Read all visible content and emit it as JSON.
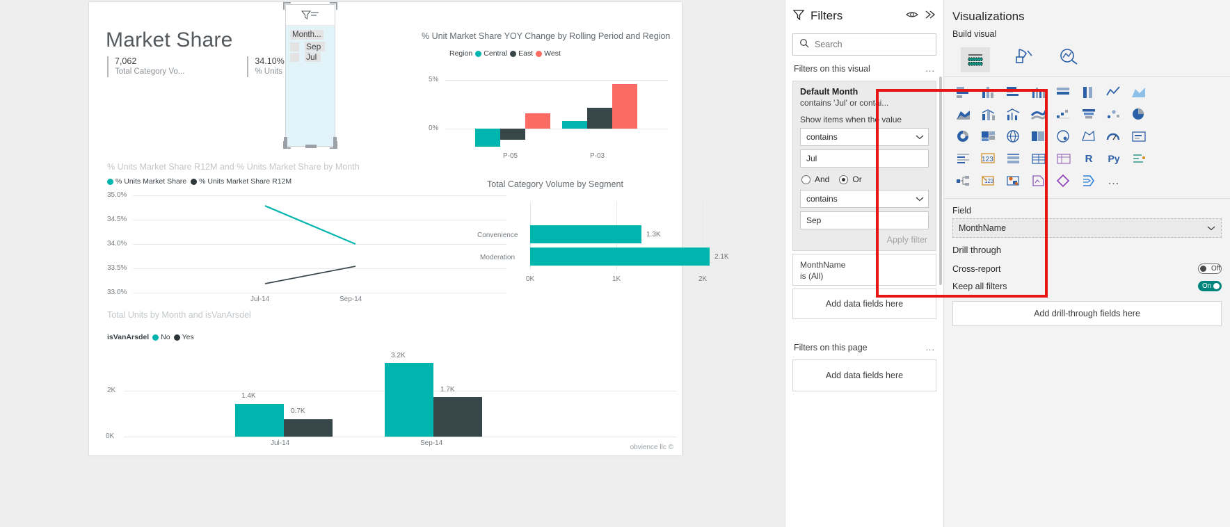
{
  "report": {
    "title": "Market Share",
    "kpis": [
      {
        "value": "7,062",
        "label": "Total Category Vo..."
      },
      {
        "value": "34.10%",
        "label": "% Units Market S..."
      }
    ],
    "watermark": "obvience llc ©",
    "slicer": {
      "icon": "funnel-icon",
      "field": "Month...",
      "items": [
        {
          "label": "Sep",
          "color": "#111111"
        },
        {
          "label": "Jul",
          "color": "#111111"
        }
      ]
    }
  },
  "colors": {
    "teal": "#00b5ad",
    "dark": "#374649",
    "red": "#fb6b63",
    "grid": "#e7e8e9",
    "accent_highlight": "#e81515"
  },
  "chart_data": [
    {
      "type": "bar",
      "name": "yoy-change",
      "title": "% Unit Market Share YOY Change by Rolling Period and Region",
      "legend_title": "Region",
      "legend_position": "top",
      "categories": [
        "P-05",
        "P-03"
      ],
      "series": [
        {
          "name": "Central",
          "color": "#00b5ad",
          "values": [
            -1.3,
            0.6
          ]
        },
        {
          "name": "East",
          "color": "#374649",
          "values": [
            -0.8,
            2.1
          ]
        },
        {
          "name": "West",
          "color": "#fb6b63",
          "values": [
            1.1,
            4.6
          ]
        }
      ],
      "ylabel": "",
      "xlabel": "",
      "yticks": [
        "5%",
        "0%"
      ],
      "ylim": [
        -2,
        5.5
      ],
      "grid": true
    },
    {
      "type": "line",
      "name": "market-share-trend",
      "title": "% Units Market Share R12M and % Units Market Share by Month",
      "legend_position": "top",
      "categories": [
        "Jul-14",
        "Sep-14"
      ],
      "series": [
        {
          "name": "% Units Market Share",
          "color": "#00b5ad",
          "values": [
            34.78,
            33.83
          ]
        },
        {
          "name": "% Units Market Share R12M",
          "color": "#374649",
          "values": [
            33.17,
            33.45
          ]
        }
      ],
      "yticks": [
        "35.0%",
        "34.5%",
        "34.0%",
        "33.5%",
        "33.0%"
      ],
      "ylim": [
        33.0,
        35.0
      ],
      "grid": true
    },
    {
      "type": "bar",
      "name": "volume-by-segment",
      "orientation": "horizontal",
      "title": "Total Category Volume by Segment",
      "categories": [
        "Convenience",
        "Moderation"
      ],
      "values": [
        1300,
        2100
      ],
      "value_labels": [
        "1.3K",
        "2.1K"
      ],
      "xticks": [
        "0K",
        "1K",
        "2K"
      ],
      "xlim": [
        0,
        2300
      ],
      "grid": true
    },
    {
      "type": "bar",
      "name": "total-units-by-month",
      "title": "Total Units by Month and isVanArsdel",
      "legend_title": "isVanArsdel",
      "legend_position": "top",
      "categories": [
        "Jul-14",
        "Sep-14"
      ],
      "series": [
        {
          "name": "No",
          "color": "#00b5ad",
          "values": [
            1400,
            3200
          ]
        },
        {
          "name": "Yes",
          "color": "#374649",
          "values": [
            700,
            1700
          ]
        }
      ],
      "value_labels": [
        [
          "1.4K",
          "3.2K"
        ],
        [
          "0.7K",
          "1.7K"
        ]
      ],
      "yticks": [
        "2K",
        "0K"
      ],
      "ylim": [
        0,
        3600
      ],
      "grid": true
    }
  ],
  "filters_pane": {
    "title": "Filters",
    "eye_icon": "eye-icon",
    "expand_icon": "chevron-double-right-icon",
    "search": {
      "placeholder": "Search",
      "value": "",
      "icon": "search-icon"
    },
    "visual_section": {
      "label": "Filters on this visual",
      "menu": "..."
    },
    "page_section": {
      "label": "Filters on this page",
      "menu": "..."
    },
    "default_month_card": {
      "title": "Default Month",
      "summary": "contains 'Jul' or contai...",
      "condition_label": "Show items when the value",
      "operator1": "contains",
      "value1": "Jul",
      "logic": {
        "and_label": "And",
        "or_label": "Or",
        "selected": "Or"
      },
      "operator2": "contains",
      "value2": "Sep",
      "apply_label": "Apply filter"
    },
    "monthname_card": {
      "title": "MonthName",
      "summary": "is (All)"
    },
    "add_fields_visual": "Add data fields here",
    "add_fields_page": "Add data fields here"
  },
  "visualizations_pane": {
    "title": "Visualizations",
    "build_label": "Build visual",
    "selected_visual": "slicer-visual-icon",
    "field_label": "Field",
    "field_value": "MonthName",
    "drill_through_label": "Drill through",
    "cross_report": {
      "label": "Cross-report",
      "state": "Off"
    },
    "keep_all_filters": {
      "label": "Keep all filters",
      "state": "On"
    },
    "add_drill_fields": "Add drill-through fields here",
    "icon_rows": [
      [
        "stacked-bar-chart-icon",
        "stacked-column-chart-icon",
        "clustered-bar-chart-icon",
        "clustered-column-chart-icon",
        "100-stacked-bar-icon",
        "100-stacked-column-icon",
        "line-chart-icon",
        "area-chart-icon"
      ],
      [
        "stacked-area-chart-icon",
        "line-stacked-column-icon",
        "line-clustered-column-icon",
        "ribbon-chart-icon",
        "waterfall-chart-icon",
        "funnel-chart-icon",
        "scatter-chart-icon",
        "pie-chart-icon"
      ],
      [
        "donut-chart-icon",
        "treemap-icon",
        "map-icon",
        "filled-map-icon",
        "azure-map-icon",
        "shape-map-icon",
        "gauge-icon",
        "card-icon"
      ],
      [
        "multi-row-card-icon",
        "kpi-icon",
        "slicer-icon",
        "table-icon",
        "matrix-icon",
        "r-script-icon",
        "python-visual-icon",
        "key-influencers-icon"
      ],
      [
        "decomposition-tree-icon",
        "smart-narrative-icon",
        "metrics-icon",
        "paginated-report-icon",
        "power-apps-icon",
        "arcgis-maps-icon",
        "visio-icon",
        "more-visuals-icon"
      ]
    ]
  }
}
